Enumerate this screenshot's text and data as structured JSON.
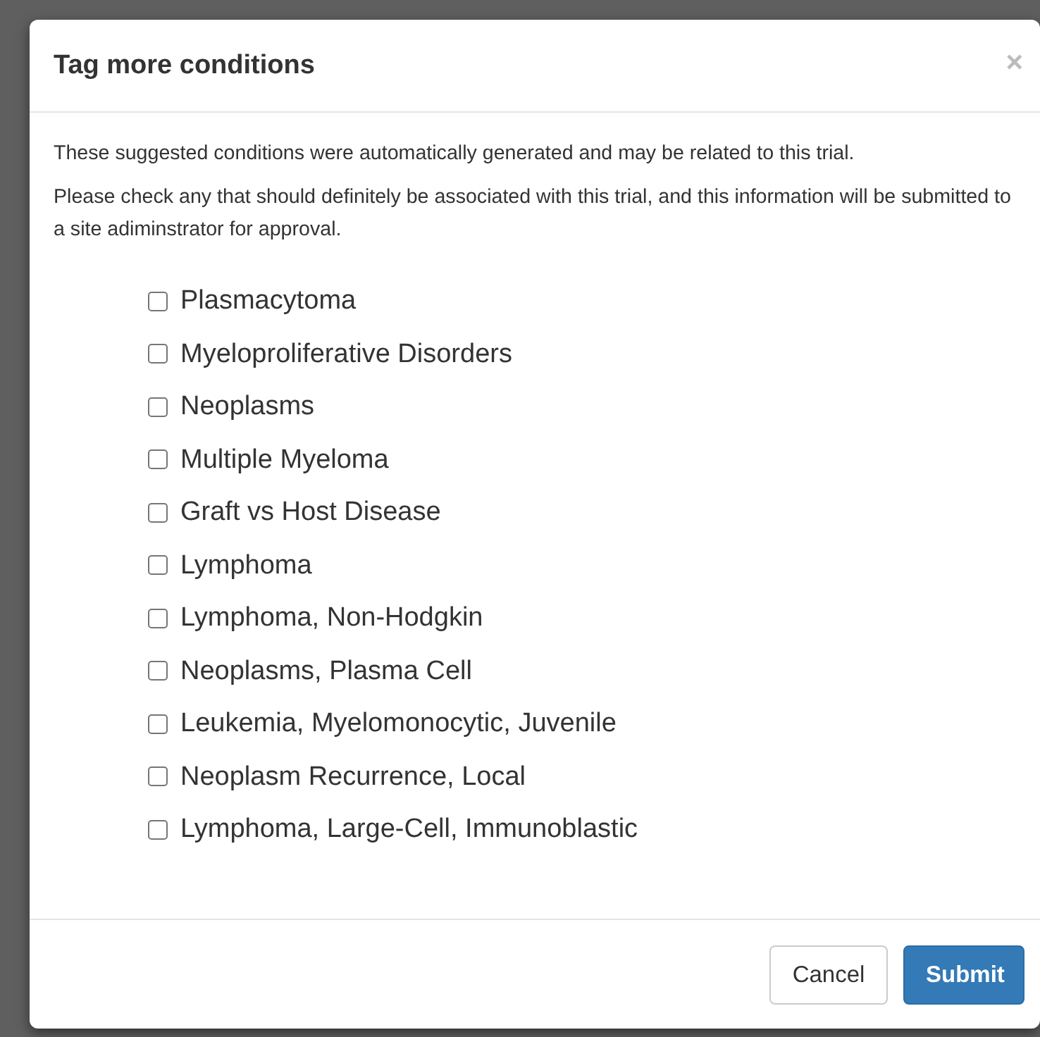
{
  "dialog": {
    "title": "Tag more conditions",
    "close": "×",
    "intro": "These suggested conditions were automatically generated and may be related to this trial.",
    "instructions": "Please check any that should definitely be associated with this trial, and this information will be submitted to a site adiminstrator for approval.",
    "conditions": [
      {
        "label": "Plasmacytoma",
        "checked": false
      },
      {
        "label": "Myeloproliferative Disorders",
        "checked": false
      },
      {
        "label": "Neoplasms",
        "checked": false
      },
      {
        "label": "Multiple Myeloma",
        "checked": false
      },
      {
        "label": "Graft vs Host Disease",
        "checked": false
      },
      {
        "label": "Lymphoma",
        "checked": false
      },
      {
        "label": "Lymphoma, Non-Hodgkin",
        "checked": false
      },
      {
        "label": "Neoplasms, Plasma Cell",
        "checked": false
      },
      {
        "label": "Leukemia, Myelomonocytic, Juvenile",
        "checked": false
      },
      {
        "label": "Neoplasm Recurrence, Local",
        "checked": false
      },
      {
        "label": "Lymphoma, Large-Cell, Immunoblastic",
        "checked": false
      }
    ],
    "buttons": [
      {
        "label": "Cancel",
        "kind": "default"
      },
      {
        "label": "Submit",
        "kind": "primary"
      }
    ]
  }
}
